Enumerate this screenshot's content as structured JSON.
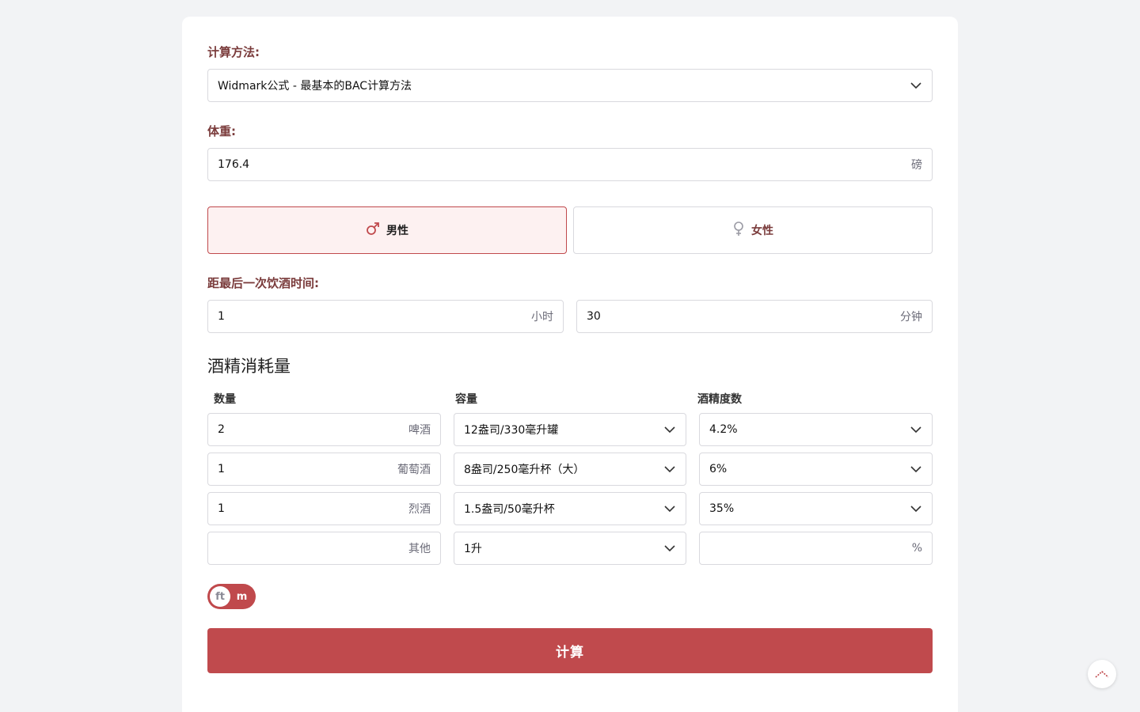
{
  "method": {
    "label": "计算方法:",
    "selected": "Widmark公式 - 最基本的BAC计算方法"
  },
  "weight": {
    "label": "体重:",
    "value": "176.4",
    "unit": "磅"
  },
  "gender": {
    "male_label": "男性",
    "female_label": "女性",
    "selected": "male"
  },
  "time": {
    "label": "距最后一次饮酒时间:",
    "hours_value": "1",
    "hours_unit": "小时",
    "minutes_value": "30",
    "minutes_unit": "分钟"
  },
  "consumption": {
    "title": "酒精消耗量",
    "col_quantity": "数量",
    "col_volume": "容量",
    "col_abv": "酒精度数",
    "rows": [
      {
        "quantity": "2",
        "type": "啤酒",
        "volume": "12盎司/330毫升罐",
        "abv": "4.2%"
      },
      {
        "quantity": "1",
        "type": "葡萄酒",
        "volume": "8盎司/250毫升杯（大）",
        "abv": "6%"
      },
      {
        "quantity": "1",
        "type": "烈酒",
        "volume": "1.5盎司/50毫升杯",
        "abv": "35%"
      },
      {
        "quantity": "",
        "type": "其他",
        "volume": "1升",
        "abv": "",
        "abv_unit": "%"
      }
    ]
  },
  "unit_toggle": {
    "on_label": "ft",
    "off_label": "m"
  },
  "calculate_label": "计算",
  "colors": {
    "accent": "#c04a4d",
    "label": "#7a3b3b",
    "selected_bg": "#fdf1f1"
  }
}
